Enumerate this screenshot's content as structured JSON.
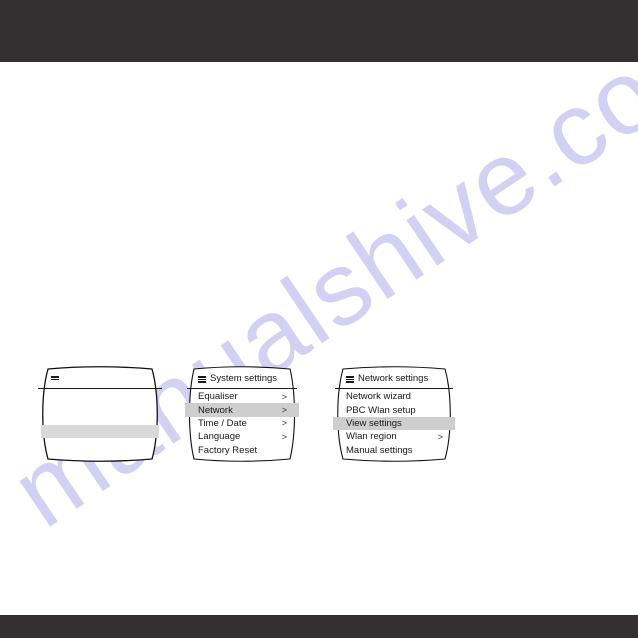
{
  "page": {
    "watermark_text": "manualshive.com",
    "band_color": "#343031",
    "highlight_color": "#cecece",
    "background_color": "#ffffff"
  },
  "screens": [
    {
      "id": "screen-now-playing",
      "title": "",
      "menu_icon": "hamburger-icon",
      "items": [],
      "has_placeholder_bar": true
    },
    {
      "id": "screen-system-settings",
      "title": "System settings",
      "menu_icon": "hamburger-icon",
      "has_placeholder_bar": false,
      "items": [
        {
          "label": "Equaliser",
          "chevron": ">",
          "selected": false
        },
        {
          "label": "Network",
          "chevron": ">",
          "selected": true
        },
        {
          "label": "Time / Date",
          "chevron": ">",
          "selected": false
        },
        {
          "label": "Language",
          "chevron": ">",
          "selected": false
        },
        {
          "label": "Factory Reset",
          "chevron": "",
          "selected": false
        }
      ]
    },
    {
      "id": "screen-network-settings",
      "title": "Network settings",
      "menu_icon": "hamburger-icon",
      "has_placeholder_bar": false,
      "items": [
        {
          "label": "Network wizard",
          "chevron": "",
          "selected": false
        },
        {
          "label": "PBC Wlan setup",
          "chevron": "",
          "selected": false
        },
        {
          "label": "View settings",
          "chevron": "",
          "selected": true
        },
        {
          "label": "Wlan region",
          "chevron": ">",
          "selected": false
        },
        {
          "label": "Manual settings",
          "chevron": "",
          "selected": false
        }
      ]
    }
  ]
}
